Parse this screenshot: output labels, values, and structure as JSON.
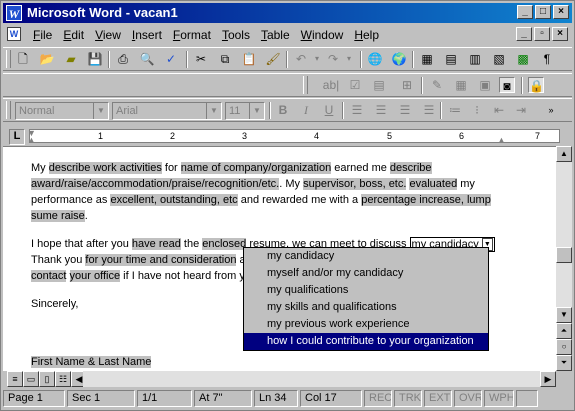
{
  "window": {
    "title": "Microsoft Word - vacan1",
    "app_icon": "W",
    "controls": [
      "_",
      "□",
      "×"
    ]
  },
  "menu": {
    "items": [
      "File",
      "Edit",
      "View",
      "Insert",
      "Format",
      "Tools",
      "Table",
      "Window",
      "Help"
    ],
    "doc_controls": [
      "_",
      "▫",
      "×"
    ]
  },
  "toolbar_format": {
    "style": "Normal",
    "font": "Arial",
    "size": "11",
    "bold": "B",
    "italic": "I",
    "underline": "U"
  },
  "toolbar_forms_text": "ab|",
  "ruler": {
    "tab_marker": "L",
    "numbers": [
      "1",
      "2",
      "3",
      "4",
      "5",
      "6",
      "7"
    ]
  },
  "document": {
    "p1": {
      "s1": "My ",
      "s2": "describe work activities",
      "s3": " for ",
      "s4": "name of company/organization",
      "s5": " earned me ",
      "s6": "describe award/raise/accommodation/praise/recognition/etc.",
      "s7": ".  My ",
      "s8": "supervisor, boss, etc.",
      "s9": " ",
      "s10": "evaluated",
      "s11": " my performance as ",
      "s12": "excellent, outstanding, etc",
      "s13": " and rewarded me with a ",
      "s14": "percentage increase, lump sume raise",
      "s15": "."
    },
    "p2": {
      "s1": "I hope that after you ",
      "s2": "have read",
      "s3": " the ",
      "s4": "enclosed",
      "s5": " resume, we can meet to discuss ",
      "field_value": "my candidacy",
      "s6": "Thank you ",
      "s7": "for your time and consideration",
      "s8": " a",
      "s9": "contact",
      "s10": " ",
      "s11": "your office",
      "s12": " if I have not heard from y"
    },
    "closing": "Sincerely,",
    "signature": "First Name & Last Name"
  },
  "dropdown": {
    "options": [
      "my candidacy",
      "myself and/or my candidacy",
      "my qualifications",
      "my skills and qualifications",
      "my previous work experience",
      "how I could contribute to your organization"
    ],
    "selected_index": 5
  },
  "status": {
    "page": "Page  1",
    "sec": "Sec  1",
    "pages": "1/1",
    "at": "At  7\"",
    "ln": "Ln  34",
    "col": "Col  17",
    "rec": "REC",
    "trk": "TRK",
    "ext": "EXT",
    "ovr": "OVR",
    "wph": "WPH"
  }
}
